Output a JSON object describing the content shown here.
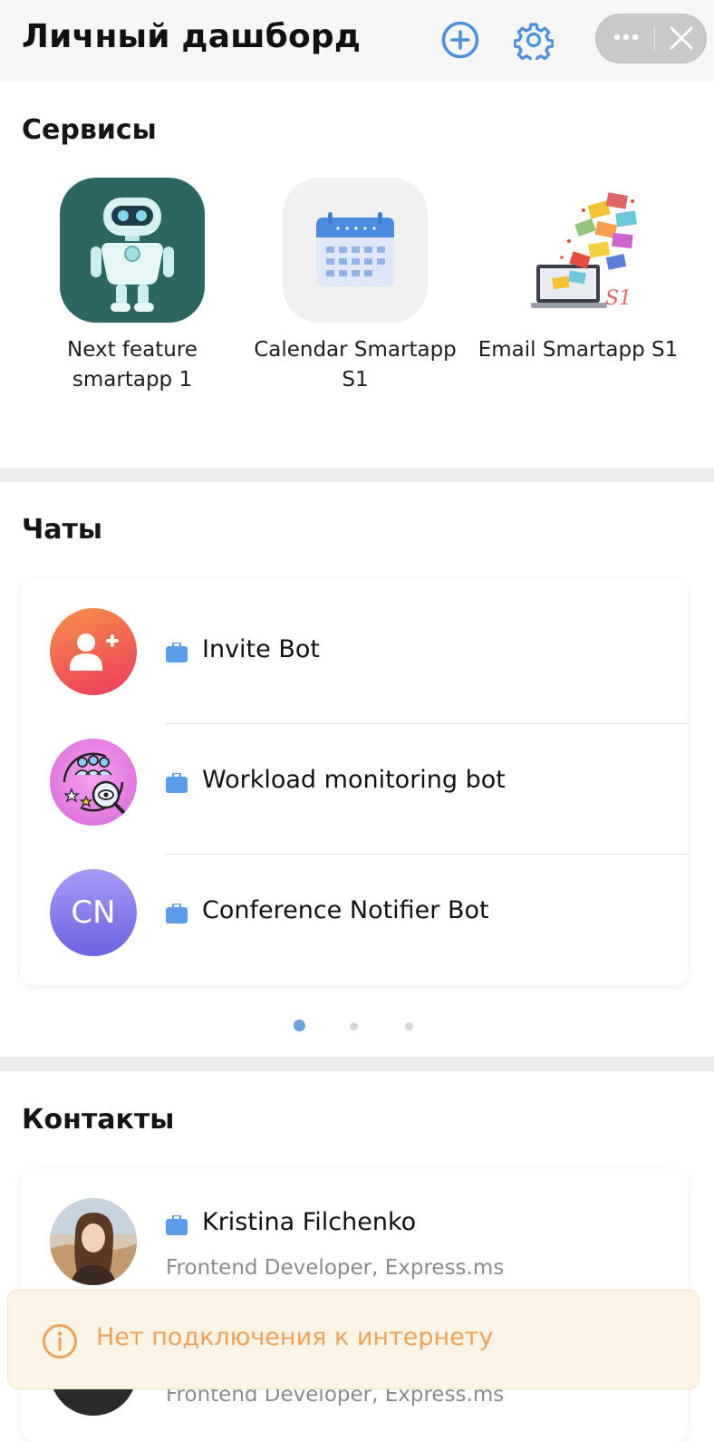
{
  "header": {
    "title": "Личный дашборд",
    "add_icon": "plus-circle-icon",
    "settings_icon": "gear-icon",
    "more_icon": "ellipsis-icon",
    "close_icon": "close-icon",
    "accent_color": "#4a90e2"
  },
  "services": {
    "title": "Сервисы",
    "items": [
      {
        "label_line1": "Next feature",
        "label_line2": "smartapp 1",
        "icon": "robot-icon"
      },
      {
        "label_line1": "Calendar Smartapp",
        "label_line2": "S1",
        "icon": "calendar-icon"
      },
      {
        "label_line1": "Email Smartapp S1",
        "label_line2": "",
        "icon": "email-envelopes-icon"
      }
    ]
  },
  "chats": {
    "title": "Чаты",
    "items": [
      {
        "name": "Invite Bot",
        "avatar": "add-user-icon"
      },
      {
        "name": "Workload monitoring bot",
        "avatar": "team-monitoring-icon"
      },
      {
        "name": "Conference Notifier Bot",
        "avatar_initials": "CN"
      }
    ],
    "pagination": {
      "pages": 3,
      "active": 1
    }
  },
  "contacts": {
    "title": "Контакты",
    "items": [
      {
        "name": "Kristina Filchenko",
        "subtitle": "Frontend Developer, Express.ms"
      },
      {
        "name": "",
        "subtitle": "Frontend Developer, Express.ms"
      }
    ]
  },
  "toast": {
    "text": "Нет подключения к интернету",
    "icon": "info-circle-icon",
    "color": "#f0a15a"
  }
}
